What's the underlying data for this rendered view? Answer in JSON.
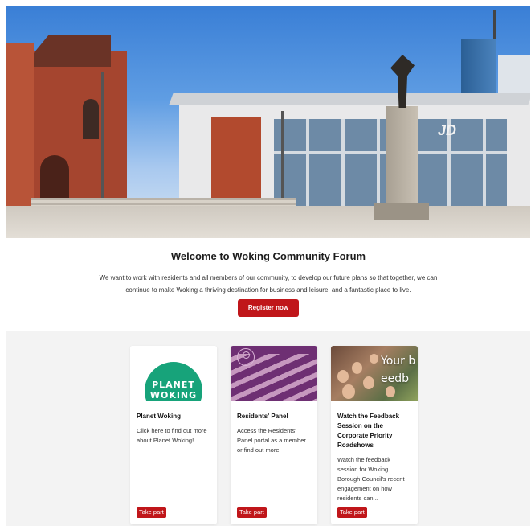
{
  "hero": {
    "image_alt": "Woking town centre square with church, shopping centre and war memorial",
    "store_sign": "JD"
  },
  "welcome": {
    "title": "Welcome to Woking Community Forum",
    "body": "We want to work with residents and all members of our community, to develop our future plans so that together, we can continue to make Woking a thriving destination for business and leisure, and a fantastic place to live.",
    "cta_label": "Register now"
  },
  "cards": [
    {
      "thumb_line1": "PLANET",
      "thumb_line2": "WOKING",
      "title": "Planet Woking",
      "description": "Click here to find out more about Planet Woking!",
      "action_label": "Take part"
    },
    {
      "title": "Residents' Panel",
      "description": "Access the Residents' Panel portal as a member or find out more.",
      "action_label": "Take part"
    },
    {
      "thumb_overlay": "Your b feedb",
      "title": "Watch the Feedback Session on the Corporate Priority Roadshows",
      "description": "Watch the feedback session for Woking Borough Council's recent engagement on how residents can...",
      "action_label": "Take part"
    }
  ],
  "colors": {
    "accent_red": "#c0161a",
    "planet_green": "#17a37a",
    "panel_purple": "#6e2f73",
    "cards_background": "#f3f3f3"
  }
}
